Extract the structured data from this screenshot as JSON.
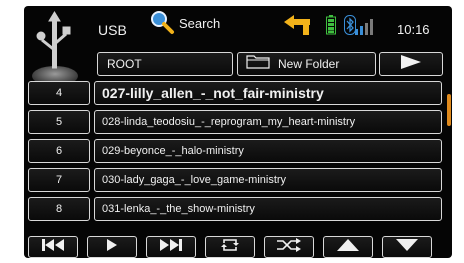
{
  "top_bar": {
    "source_label": "USB",
    "search_label": "Search",
    "time": "10:16"
  },
  "path_row": {
    "current_folder": "ROOT",
    "new_folder_label": "New Folder"
  },
  "tracks": [
    {
      "number": "4",
      "title": "027-lilly_allen_-_not_fair-ministry",
      "selected": true
    },
    {
      "number": "5",
      "title": "028-linda_teodosiu_-_reprogram_my_heart-ministry",
      "selected": false
    },
    {
      "number": "6",
      "title": "029-beyonce_-_halo-ministry",
      "selected": false
    },
    {
      "number": "7",
      "title": "030-lady_gaga_-_love_game-ministry",
      "selected": false
    },
    {
      "number": "8",
      "title": "031-lenka_-_the_show-ministry",
      "selected": false
    }
  ],
  "colors": {
    "screen_bg": "#050505",
    "text": "#f0f0f0",
    "border": "#d8d8d8",
    "accent_yellow": "#f2b21a",
    "accent_green": "#3fbf3f",
    "accent_blue": "#3a8fd8",
    "scroll_thumb": "#e08a1c"
  },
  "icons": {
    "source": "usb-icon",
    "search": "magnifier-icon",
    "navigation": "nav-arrow-icon",
    "battery": "battery-icon",
    "bluetooth": "bluetooth-icon",
    "signal": "signal-bars-icon",
    "folder": "folder-icon",
    "controls": [
      "previous-track-icon",
      "play-icon",
      "next-track-icon",
      "repeat-icon",
      "shuffle-icon",
      "scroll-up-icon",
      "scroll-down-icon"
    ]
  }
}
